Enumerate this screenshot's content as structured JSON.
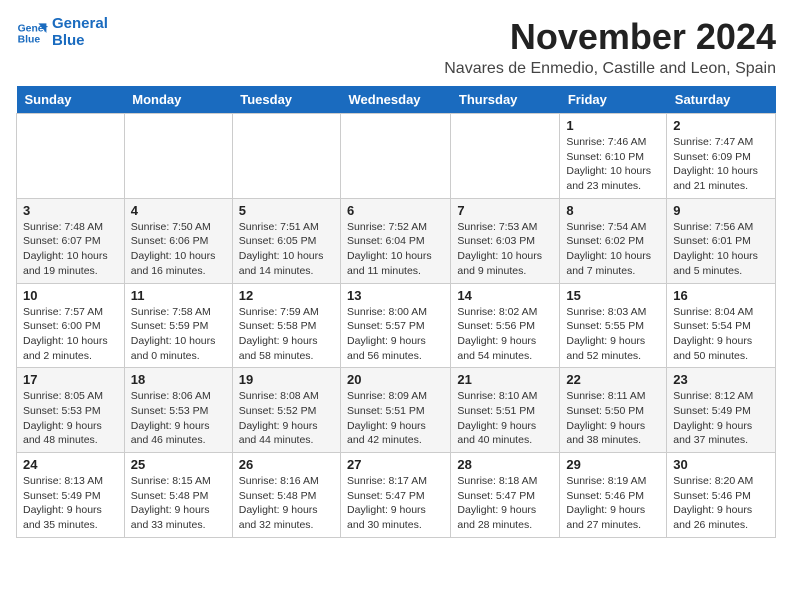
{
  "logo": {
    "line1": "General",
    "line2": "Blue"
  },
  "header": {
    "month": "November 2024",
    "location": "Navares de Enmedio, Castille and Leon, Spain"
  },
  "weekdays": [
    "Sunday",
    "Monday",
    "Tuesday",
    "Wednesday",
    "Thursday",
    "Friday",
    "Saturday"
  ],
  "weeks": [
    [
      {
        "day": "",
        "info": ""
      },
      {
        "day": "",
        "info": ""
      },
      {
        "day": "",
        "info": ""
      },
      {
        "day": "",
        "info": ""
      },
      {
        "day": "",
        "info": ""
      },
      {
        "day": "1",
        "info": "Sunrise: 7:46 AM\nSunset: 6:10 PM\nDaylight: 10 hours and 23 minutes."
      },
      {
        "day": "2",
        "info": "Sunrise: 7:47 AM\nSunset: 6:09 PM\nDaylight: 10 hours and 21 minutes."
      }
    ],
    [
      {
        "day": "3",
        "info": "Sunrise: 7:48 AM\nSunset: 6:07 PM\nDaylight: 10 hours and 19 minutes."
      },
      {
        "day": "4",
        "info": "Sunrise: 7:50 AM\nSunset: 6:06 PM\nDaylight: 10 hours and 16 minutes."
      },
      {
        "day": "5",
        "info": "Sunrise: 7:51 AM\nSunset: 6:05 PM\nDaylight: 10 hours and 14 minutes."
      },
      {
        "day": "6",
        "info": "Sunrise: 7:52 AM\nSunset: 6:04 PM\nDaylight: 10 hours and 11 minutes."
      },
      {
        "day": "7",
        "info": "Sunrise: 7:53 AM\nSunset: 6:03 PM\nDaylight: 10 hours and 9 minutes."
      },
      {
        "day": "8",
        "info": "Sunrise: 7:54 AM\nSunset: 6:02 PM\nDaylight: 10 hours and 7 minutes."
      },
      {
        "day": "9",
        "info": "Sunrise: 7:56 AM\nSunset: 6:01 PM\nDaylight: 10 hours and 5 minutes."
      }
    ],
    [
      {
        "day": "10",
        "info": "Sunrise: 7:57 AM\nSunset: 6:00 PM\nDaylight: 10 hours and 2 minutes."
      },
      {
        "day": "11",
        "info": "Sunrise: 7:58 AM\nSunset: 5:59 PM\nDaylight: 10 hours and 0 minutes."
      },
      {
        "day": "12",
        "info": "Sunrise: 7:59 AM\nSunset: 5:58 PM\nDaylight: 9 hours and 58 minutes."
      },
      {
        "day": "13",
        "info": "Sunrise: 8:00 AM\nSunset: 5:57 PM\nDaylight: 9 hours and 56 minutes."
      },
      {
        "day": "14",
        "info": "Sunrise: 8:02 AM\nSunset: 5:56 PM\nDaylight: 9 hours and 54 minutes."
      },
      {
        "day": "15",
        "info": "Sunrise: 8:03 AM\nSunset: 5:55 PM\nDaylight: 9 hours and 52 minutes."
      },
      {
        "day": "16",
        "info": "Sunrise: 8:04 AM\nSunset: 5:54 PM\nDaylight: 9 hours and 50 minutes."
      }
    ],
    [
      {
        "day": "17",
        "info": "Sunrise: 8:05 AM\nSunset: 5:53 PM\nDaylight: 9 hours and 48 minutes."
      },
      {
        "day": "18",
        "info": "Sunrise: 8:06 AM\nSunset: 5:53 PM\nDaylight: 9 hours and 46 minutes."
      },
      {
        "day": "19",
        "info": "Sunrise: 8:08 AM\nSunset: 5:52 PM\nDaylight: 9 hours and 44 minutes."
      },
      {
        "day": "20",
        "info": "Sunrise: 8:09 AM\nSunset: 5:51 PM\nDaylight: 9 hours and 42 minutes."
      },
      {
        "day": "21",
        "info": "Sunrise: 8:10 AM\nSunset: 5:51 PM\nDaylight: 9 hours and 40 minutes."
      },
      {
        "day": "22",
        "info": "Sunrise: 8:11 AM\nSunset: 5:50 PM\nDaylight: 9 hours and 38 minutes."
      },
      {
        "day": "23",
        "info": "Sunrise: 8:12 AM\nSunset: 5:49 PM\nDaylight: 9 hours and 37 minutes."
      }
    ],
    [
      {
        "day": "24",
        "info": "Sunrise: 8:13 AM\nSunset: 5:49 PM\nDaylight: 9 hours and 35 minutes."
      },
      {
        "day": "25",
        "info": "Sunrise: 8:15 AM\nSunset: 5:48 PM\nDaylight: 9 hours and 33 minutes."
      },
      {
        "day": "26",
        "info": "Sunrise: 8:16 AM\nSunset: 5:48 PM\nDaylight: 9 hours and 32 minutes."
      },
      {
        "day": "27",
        "info": "Sunrise: 8:17 AM\nSunset: 5:47 PM\nDaylight: 9 hours and 30 minutes."
      },
      {
        "day": "28",
        "info": "Sunrise: 8:18 AM\nSunset: 5:47 PM\nDaylight: 9 hours and 28 minutes."
      },
      {
        "day": "29",
        "info": "Sunrise: 8:19 AM\nSunset: 5:46 PM\nDaylight: 9 hours and 27 minutes."
      },
      {
        "day": "30",
        "info": "Sunrise: 8:20 AM\nSunset: 5:46 PM\nDaylight: 9 hours and 26 minutes."
      }
    ]
  ]
}
